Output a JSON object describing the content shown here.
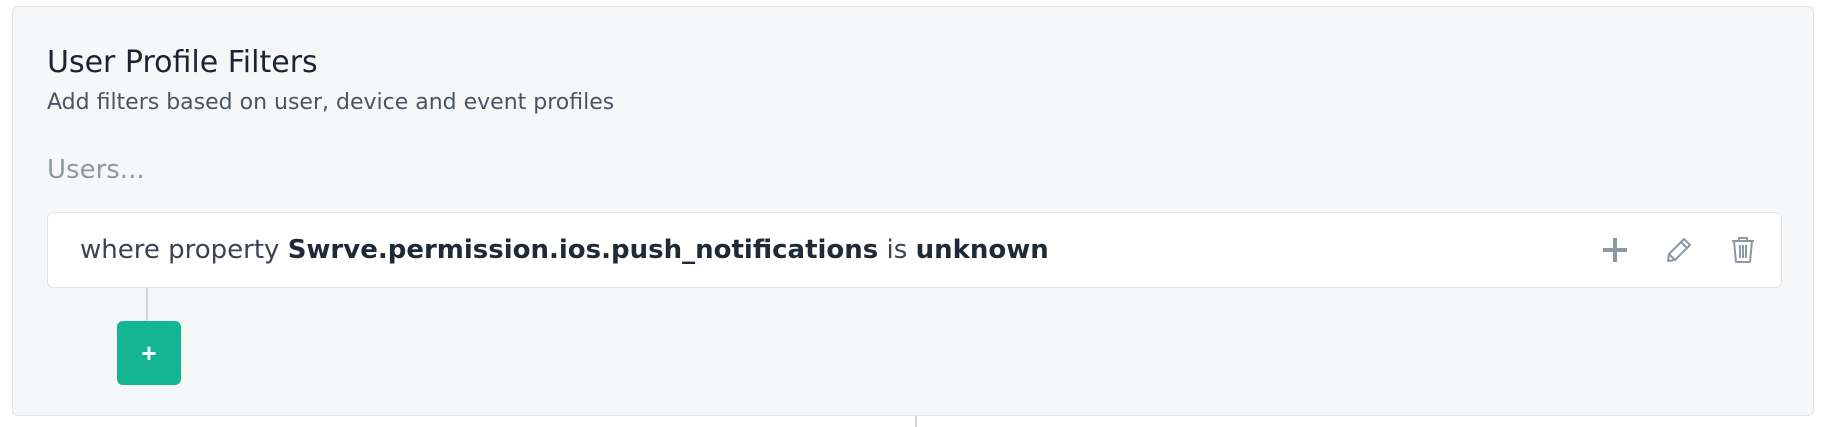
{
  "section": {
    "title": "User Profile Filters",
    "subtitle": "Add filters based on user, device and event profiles",
    "users_label": "Users..."
  },
  "filter": {
    "prefix": "where property",
    "property": "Swrve.permission.ios.push_notifications",
    "operator": "is",
    "value": "unknown",
    "actions": {
      "add_icon": "plus-icon",
      "edit_icon": "pencil-icon",
      "delete_icon": "trash-icon"
    }
  },
  "add_button": {
    "label": "+"
  },
  "colors": {
    "accent": "#13b592",
    "panel_bg": "#f6f7f9",
    "icon_gray": "#8e97a2"
  }
}
